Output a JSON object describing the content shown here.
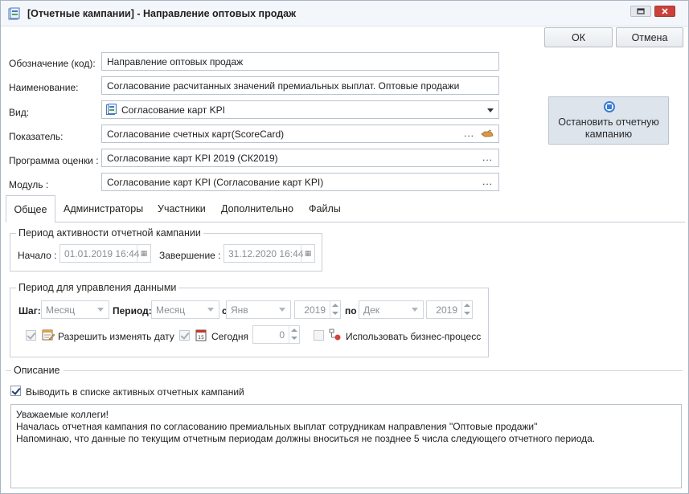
{
  "window": {
    "title": "[Отчетные кампании] - Направление оптовых продаж"
  },
  "actions": {
    "ok": "ОК",
    "cancel": "Отмена",
    "stop_campaign": "Остановить отчетную кампанию"
  },
  "form": {
    "code_label": "Обозначение (код):",
    "code_value": "Направление оптовых продаж",
    "name_label": "Наименование:",
    "name_value": "Согласование расчитанных значений премиальных выплат. Оптовые продажи",
    "type_label": "Вид:",
    "type_value": "Согласование карт KPI",
    "indicator_label": "Показатель:",
    "indicator_value": "Согласование счетных карт(ScoreCard)",
    "program_label": "Программа оценки :",
    "program_value": "Согласование карт KPI 2019 (СК2019)",
    "module_label": "Модуль :",
    "module_value": "Согласование карт KPI (Согласование карт KPI)",
    "ellipsis": "..."
  },
  "tabs": [
    {
      "label": "Общее",
      "active": true
    },
    {
      "label": "Администраторы",
      "active": false
    },
    {
      "label": "Участники",
      "active": false
    },
    {
      "label": "Дополнительно",
      "active": false
    },
    {
      "label": "Файлы",
      "active": false
    }
  ],
  "activity_period": {
    "title": "Период активности отчетной кампании",
    "start_label": "Начало :",
    "start_value": "01.01.2019 16:44",
    "end_label": "Завершение :",
    "end_value": "31.12.2020 16:44"
  },
  "data_period": {
    "title": "Период для управления данными",
    "step_label": "Шаг:",
    "step_value": "Месяц",
    "period_label": "Период:",
    "period_value": "Месяц",
    "from_label": "с",
    "from_month": "Янв",
    "from_year": "2019",
    "to_label": "по",
    "to_month": "Дек",
    "to_year": "2019",
    "allow_change_label": "Разрешить изменять дату",
    "today_label": "Сегодня",
    "today_value": "0",
    "business_process_label": "Использовать бизнес-процесс"
  },
  "description": {
    "title": "Описание",
    "show_active_label": "Выводить в списке активных отчетных кампаний",
    "text_lines": [
      "Уважаемые коллеги!",
      "Началась отчетная кампания по согласованию премиальных выплат сотрудникам направления \"Оптовые продажи\"",
      "Напоминаю, что данные по текущим отчетным периодам должны вноситься не позднее 5 числа следующего отчетного периода."
    ]
  },
  "colors": {
    "accent": "#3a7bd5",
    "close_button": "#c9413a"
  }
}
